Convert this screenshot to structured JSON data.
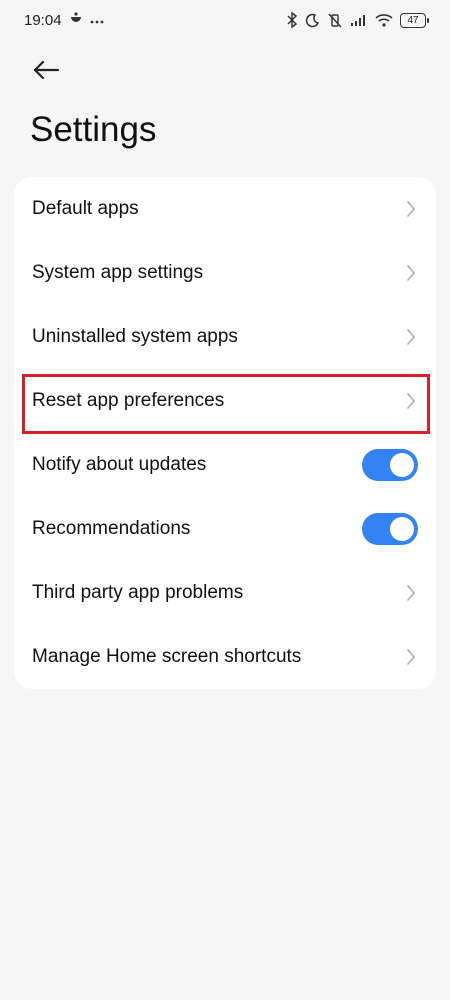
{
  "status_bar": {
    "time": "19:04",
    "left_icons": [
      "notification-app-icon",
      "more-dots-icon"
    ],
    "right_icons": [
      "bluetooth-icon",
      "do-not-disturb-moon-icon",
      "vibrate-off-icon",
      "signal-icon",
      "wifi-icon"
    ],
    "battery": "47"
  },
  "header": {
    "back_icon": "back-arrow-icon",
    "title": "Settings"
  },
  "settings": {
    "items": [
      {
        "label": "Default apps",
        "control": "chevron"
      },
      {
        "label": "System app settings",
        "control": "chevron"
      },
      {
        "label": "Uninstalled system apps",
        "control": "chevron"
      },
      {
        "label": "Reset app preferences",
        "control": "chevron",
        "highlighted": true
      },
      {
        "label": "Notify about updates",
        "control": "toggle",
        "on": true
      },
      {
        "label": "Recommendations",
        "control": "toggle",
        "on": true
      },
      {
        "label": "Third party app problems",
        "control": "chevron"
      },
      {
        "label": "Manage Home screen shortcuts",
        "control": "chevron"
      }
    ]
  },
  "colors": {
    "background": "#f6f6f6",
    "card": "#ffffff",
    "toggle_on": "#3483f5",
    "highlight": "#d6202b",
    "chevron": "#b8b8b8"
  }
}
